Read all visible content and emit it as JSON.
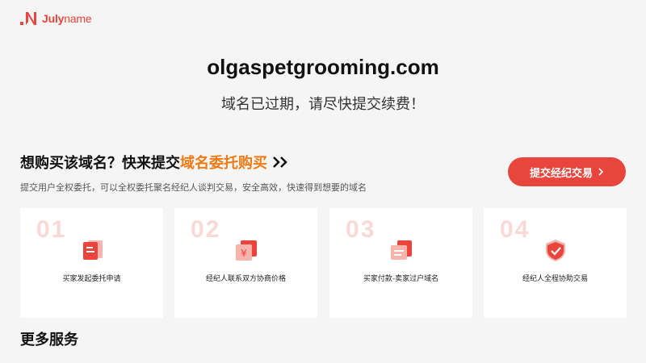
{
  "header": {
    "logo_text_bold": "Julyname",
    "logo_text_bold_part": "July",
    "logo_text_light_part": "name",
    "brand_color": "#e8453c"
  },
  "domain": {
    "name": "olgaspetgrooming.com",
    "status_message": "域名已过期，请尽快提交续费！"
  },
  "buy_section": {
    "heading_prefix": "想购买该域名？快来提交",
    "heading_highlight": "域名委托购买",
    "highlight_color": "#f07b14",
    "subtitle": "提交用户全权委托，可以全权委托聚名经纪人谈判交易，安全高效，快速得到想要的域名",
    "submit_button": "提交经纪交易"
  },
  "steps": [
    {
      "number": "01",
      "label": "买家发起委托申请",
      "icon": "document-icon"
    },
    {
      "number": "02",
      "label": "经纪人联系双方协商价格",
      "icon": "yuan-icon"
    },
    {
      "number": "03",
      "label": "买家付款-卖家过户域名",
      "icon": "transfer-icon"
    },
    {
      "number": "04",
      "label": "经纪人全程协助交易",
      "icon": "shield-check-icon"
    }
  ],
  "more_section": {
    "heading": "更多服务"
  }
}
